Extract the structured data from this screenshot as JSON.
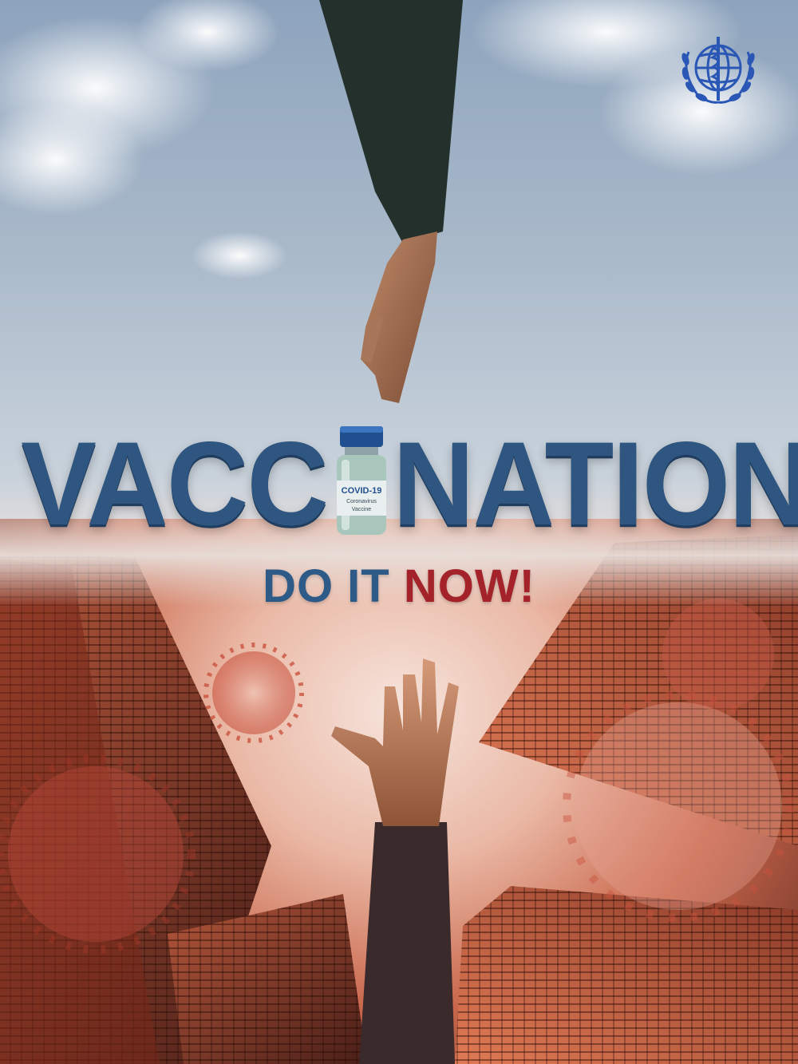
{
  "poster": {
    "headline_left": "VACC",
    "headline_right": "NATION",
    "vial_line1": "COVID-19",
    "vial_line2": "Coronavirus",
    "vial_line3": "Vaccine",
    "tagline_part1": "DO IT",
    "tagline_part2": "NOW!",
    "logo": "who-emblem-icon"
  },
  "colors": {
    "headline": "#2f5680",
    "tagline_blue": "#2d5a86",
    "tagline_red": "#a4222a",
    "sky": "#a8b8c9",
    "buildings": "#c9674b"
  }
}
